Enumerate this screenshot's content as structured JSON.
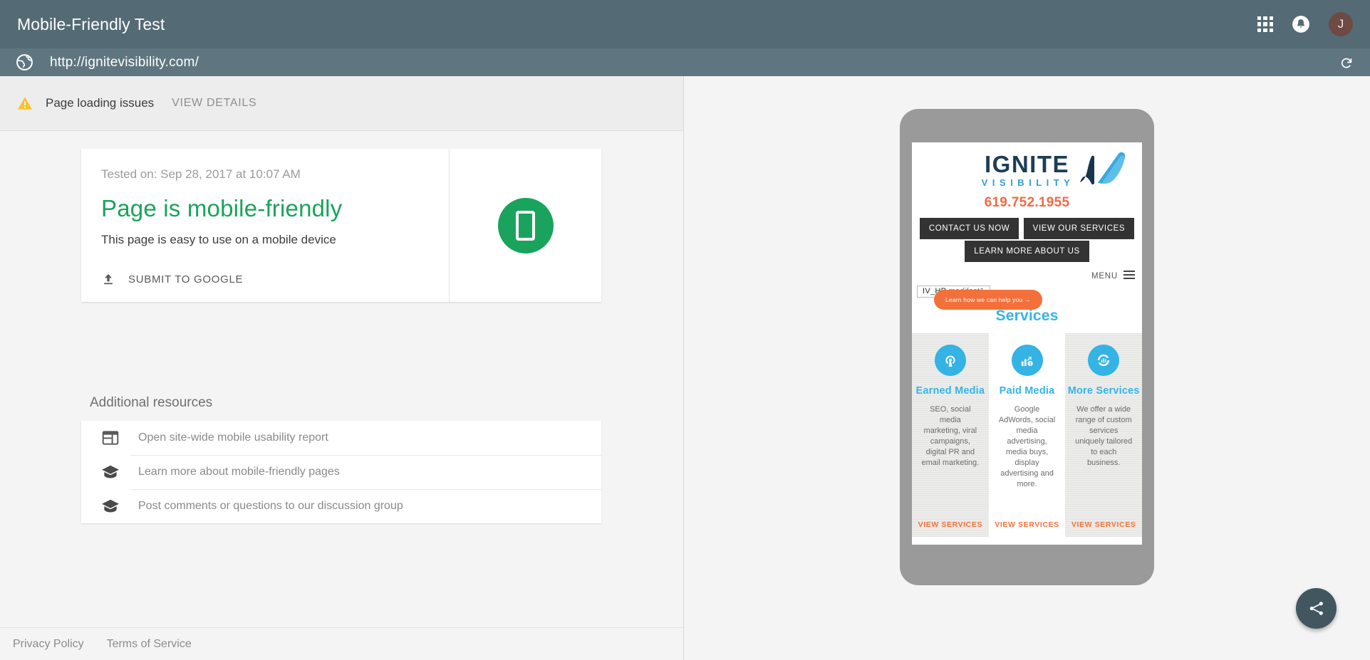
{
  "appbar": {
    "title": "Mobile-Friendly Test",
    "apps_icon": "apps-grid-icon",
    "notifications_icon": "bell-icon",
    "avatar_initial": "J",
    "avatar_color": "#6d4a42",
    "background": "#546a75"
  },
  "urlbar": {
    "globe_icon": "globe-icon",
    "url": "http://ignitevisibility.com/",
    "reload_icon": "reload-icon",
    "background": "#5f7680"
  },
  "warning": {
    "icon": "warning-triangle-icon",
    "icon_color": "#fbc02d",
    "text": "Page loading issues",
    "link": "VIEW DETAILS"
  },
  "result": {
    "tested_on": "Tested on: Sep 28, 2017 at 10:07 AM",
    "verdict": "Page is mobile-friendly",
    "verdict_color": "#1aa35c",
    "subtext": "This page is easy to use on a mobile device",
    "submit_icon": "upload-icon",
    "submit_label": "SUBMIT TO GOOGLE",
    "badge_icon": "mobile-phone-icon",
    "badge_color": "#1aa35c"
  },
  "resources": {
    "title": "Additional resources",
    "items": [
      {
        "icon": "report-icon",
        "label": "Open site-wide mobile usability report"
      },
      {
        "icon": "school-icon",
        "label": "Learn more about mobile-friendly pages"
      },
      {
        "icon": "school-icon",
        "label": "Post comments or questions to our discussion group"
      }
    ]
  },
  "footer": {
    "privacy": "Privacy Policy",
    "terms": "Terms of Service"
  },
  "fab": {
    "icon": "share-icon",
    "color": "#41565f"
  },
  "preview": {
    "brand_name": "IGNITE",
    "brand_sub": "VISIBILITY",
    "brand_color": "#1d3d55",
    "brand_sub_color": "#2e9fd4",
    "phone_number": "619.752.1955",
    "phone_color": "#f26a43",
    "buttons": [
      "CONTACT US NOW",
      "VIEW OUR SERVICES",
      "LEARN MORE ABOUT US"
    ],
    "menu_label": "MENU",
    "menu_icon": "hamburger-icon",
    "tag_primary": "IV_HP",
    "tag_secondary": "medifast1",
    "services_heading": "Services",
    "cta_label": "Learn how we can help you  →",
    "cta_color": "#f4703a",
    "cards": [
      {
        "icon": "broadcast-icon",
        "title": "Earned Media",
        "body": "SEO, social media marketing, viral campaigns, digital PR and email marketing.",
        "link": "VIEW SERVICES"
      },
      {
        "icon": "bar-chart-growth-icon",
        "title": "Paid Media",
        "body": "Google AdWords, social media advertising, media buys, display advertising and more.",
        "link": "VIEW SERVICES"
      },
      {
        "icon": "analytics-circle-icon",
        "title": "More Services",
        "body": "We offer a wide range of custom services uniquely tailored to each business.",
        "link": "VIEW SERVICES"
      }
    ],
    "accent_color": "#35b4e8"
  }
}
